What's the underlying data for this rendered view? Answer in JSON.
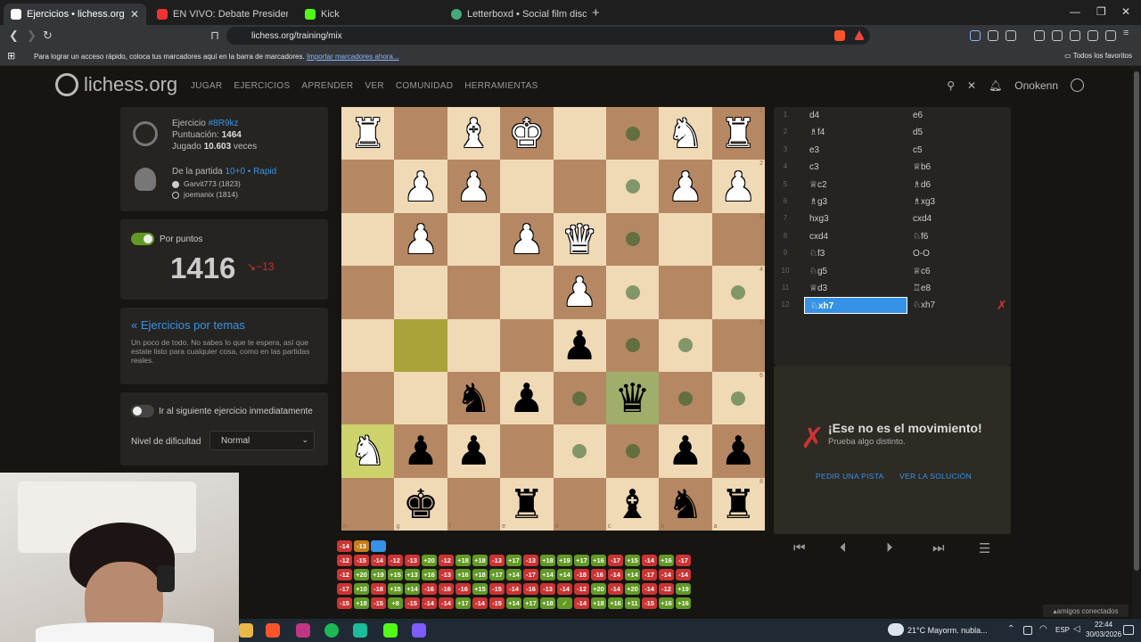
{
  "browser": {
    "tabs": [
      {
        "title": "Ejercicios • lichess.org",
        "active": true,
        "icon": "lichess-icon"
      },
      {
        "title": "EN VIVO: Debate Presidencia",
        "active": false,
        "icon": "youtube-icon"
      },
      {
        "title": "Kick",
        "active": false,
        "icon": "kick-icon"
      },
      {
        "title": "Letterboxd • Social film discovery.",
        "active": false,
        "icon": "letterboxd-icon"
      }
    ],
    "url": "lichess.org/training/mix",
    "bookmarks_message": "Para lograr un acceso rápido, coloca tus marcadores aquí en la barra de marcadores.",
    "bookmarks_import": "Importar marcadores ahora...",
    "all_favorites": "Todos los favoritos"
  },
  "header": {
    "logo": "lichess.org",
    "nav": [
      "JUGAR",
      "EJERCICIOS",
      "APRENDER",
      "VER",
      "COMUNIDAD",
      "HERRAMIENTAS"
    ],
    "username": "Onokenn"
  },
  "puzzle": {
    "label": "Ejercicio",
    "id": "#8R9kz",
    "rating_label": "Puntuación:",
    "rating": "1464",
    "played_label": "Jugado",
    "played": "10.603",
    "played_suffix": "veces",
    "game_label": "De la partida",
    "game_type": "10+0 • Rapid",
    "white_player": "Garvit773 (1823)",
    "black_player": "joemanix (1814)"
  },
  "score": {
    "toggle_label": "Por puntos",
    "value": "1416",
    "delta": "−13",
    "toggle_on": true
  },
  "themes": {
    "title": "« Ejercicios por temas",
    "description": "Un poco de todo. No sabes lo que te espera, así que estate listo para cualquier cosa, como en las partidas reales."
  },
  "options": {
    "next_label": "Ir al siguiente ejercicio inmediatamente",
    "next_on": false,
    "difficulty_label": "Nivel de dificultad",
    "difficulty_value": "Normal"
  },
  "board": {
    "flipped": true,
    "rank_labels": [
      "1",
      "2",
      "3",
      "4",
      "5",
      "6",
      "7",
      "8"
    ],
    "file_labels": [
      "h",
      "g",
      "f",
      "e",
      "d",
      "c",
      "b",
      "a"
    ],
    "rows": [
      [
        "wR",
        "",
        "wB",
        "wK",
        "",
        "dot",
        "wN",
        "wR"
      ],
      [
        "",
        "wP",
        "wP",
        "",
        "",
        "dot",
        "wP",
        "wP"
      ],
      [
        "",
        "wP",
        "",
        "wP",
        "wQ",
        "dot",
        "",
        ""
      ],
      [
        "",
        "",
        "",
        "",
        "wP",
        "dot",
        "",
        "dot"
      ],
      [
        "",
        "",
        "",
        "",
        "bP",
        "dot",
        "dot",
        ""
      ],
      [
        "",
        "",
        "bN",
        "bP",
        "dot",
        "bQ",
        "dot",
        "dot"
      ],
      [
        "wN",
        "bP",
        "bP",
        "",
        "dot",
        "dot",
        "bP",
        "bP"
      ],
      [
        "",
        "bK",
        "",
        "bR",
        "",
        "bB",
        "bN",
        "bR"
      ]
    ]
  },
  "moves": [
    {
      "n": "1",
      "w": "d4",
      "b": "e6"
    },
    {
      "n": "2",
      "w": "♗f4",
      "b": "d5"
    },
    {
      "n": "3",
      "w": "e3",
      "b": "c5"
    },
    {
      "n": "4",
      "w": "c3",
      "b": "♕b6"
    },
    {
      "n": "5",
      "w": "♕c2",
      "b": "♗d6"
    },
    {
      "n": "6",
      "w": "♗g3",
      "b": "♗xg3"
    },
    {
      "n": "7",
      "w": "hxg3",
      "b": "cxd4"
    },
    {
      "n": "8",
      "w": "cxd4",
      "b": "♘f6"
    },
    {
      "n": "9",
      "w": "♘f3",
      "b": "O-O"
    },
    {
      "n": "10",
      "w": "♘g5",
      "b": "♕c6"
    },
    {
      "n": "11",
      "w": "♕d3",
      "b": "♖e8"
    },
    {
      "n": "12",
      "w": "♘xh7",
      "b": "♘xh7"
    }
  ],
  "feedback": {
    "title": "¡Ese no es el movimiento!",
    "subtitle": "Prueba algo distinto.",
    "hint_button": "PEDIR UNA PISTA",
    "solution_button": "VER LA SOLUCIÓN"
  },
  "history": [
    [
      "-14",
      "-13",
      ""
    ],
    [
      "-12",
      "-15",
      "-14",
      "-12",
      "-13",
      "+20",
      "-12",
      "+18",
      "+18",
      "-13",
      "+17",
      "-13",
      "+18",
      "+19",
      "+17",
      "+16",
      "-17",
      "+15",
      "-14",
      "+16",
      "-17"
    ],
    [
      "-12",
      "+20",
      "+19",
      "+15",
      "+13",
      "+16",
      "-13",
      "+16",
      "+18",
      "+17",
      "+14",
      "-17",
      "+14",
      "+14",
      "-18",
      "-16",
      "-14",
      "+14",
      "-17",
      "-14",
      "-14"
    ],
    [
      "-17",
      "+10",
      "-18",
      "+15",
      "+14",
      "-16",
      "-16",
      "-16",
      "+15",
      "-15",
      "-14",
      "-16",
      "-13",
      "-14",
      "-12",
      "+20",
      "-14",
      "+20",
      "-14",
      "-12",
      "+19"
    ],
    [
      "-15",
      "+18",
      "-15",
      "+8",
      "-15",
      "-14",
      "-14",
      "+17",
      "-14",
      "-15",
      "+14",
      "+17",
      "+18",
      "✓",
      "-14",
      "+18",
      "+16",
      "+11",
      "-15",
      "+16",
      "+16"
    ]
  ],
  "friends": "amigos conectados",
  "taskbar": {
    "weather": "21°C  Mayorm. nubla...",
    "lang": "ESP",
    "time": "22:44",
    "date": "30/03/2026"
  },
  "colors": {
    "accent_blue": "#3692e7",
    "error_red": "#cc3333",
    "success_green": "#629924"
  }
}
